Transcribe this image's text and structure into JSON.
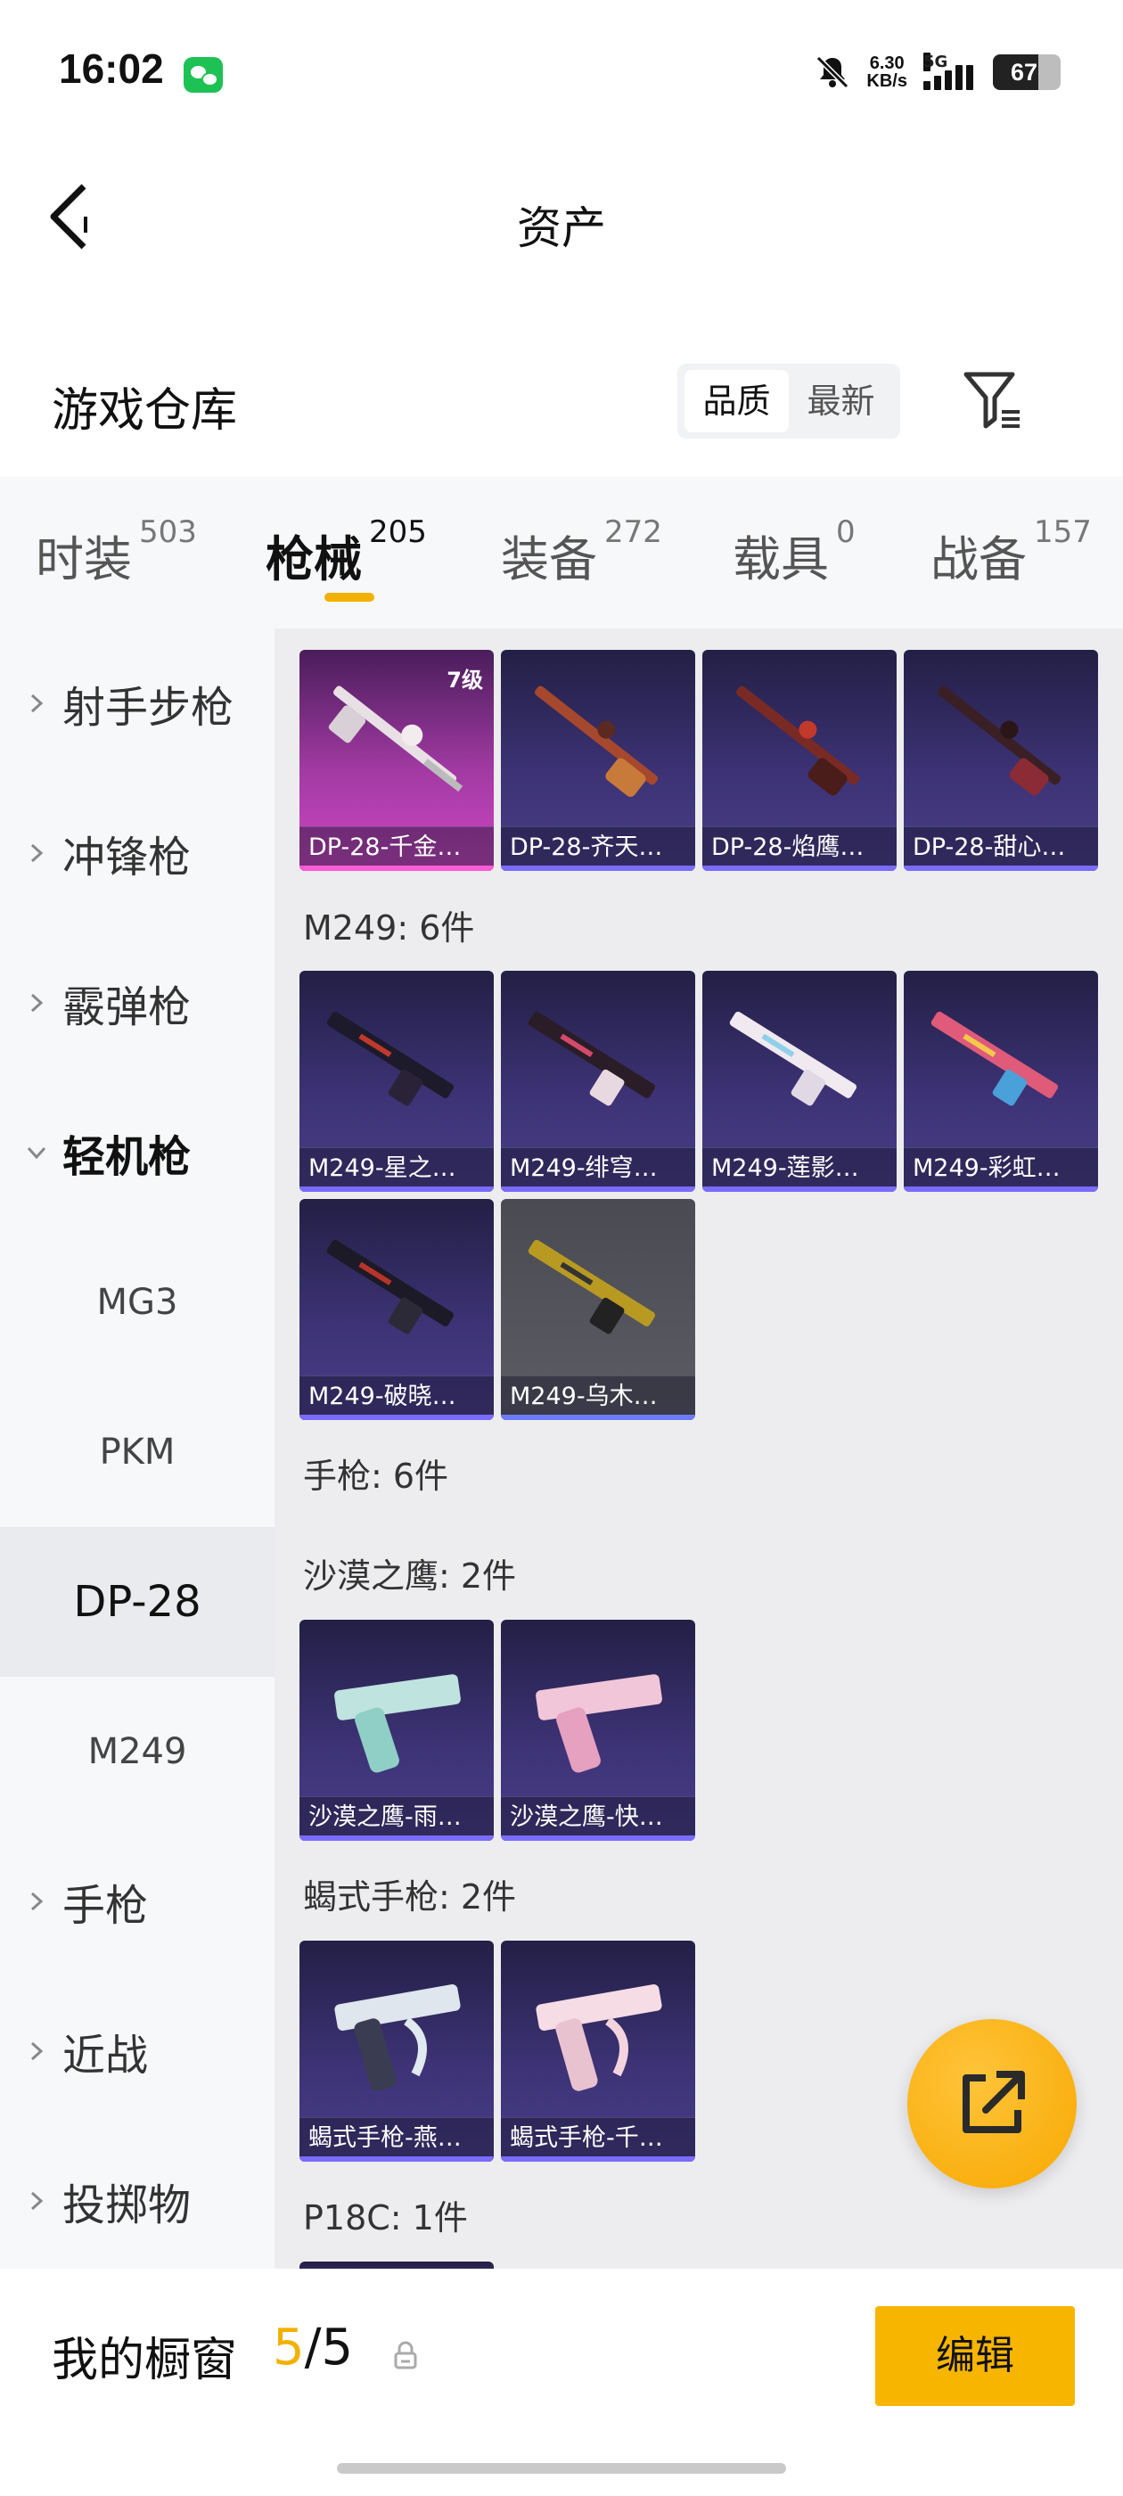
{
  "status_bar": {
    "time": "16:02",
    "net_speed_value": "6.30",
    "net_speed_unit": "KB/s",
    "network": "5G",
    "battery": "67"
  },
  "nav": {
    "title": "资产"
  },
  "warehouse": {
    "title": "游戏仓库",
    "sort_options": [
      "品质",
      "最新"
    ],
    "active_sort": "品质"
  },
  "tabs": [
    {
      "label": "时装",
      "count": "503"
    },
    {
      "label": "枪械",
      "count": "205"
    },
    {
      "label": "装备",
      "count": "272"
    },
    {
      "label": "载具",
      "count": "0"
    },
    {
      "label": "战备",
      "count": "157"
    }
  ],
  "active_tab": "枪械",
  "sidebar": {
    "items": [
      {
        "label": "射手步枪",
        "type": "category"
      },
      {
        "label": "冲锋枪",
        "type": "category"
      },
      {
        "label": "霰弹枪",
        "type": "category"
      },
      {
        "label": "轻机枪",
        "type": "category",
        "expanded": true
      },
      {
        "label": "MG3",
        "type": "sub"
      },
      {
        "label": "PKM",
        "type": "sub"
      },
      {
        "label": "DP-28",
        "type": "sub",
        "selected": true
      },
      {
        "label": "M249",
        "type": "sub"
      },
      {
        "label": "手枪",
        "type": "category"
      },
      {
        "label": "近战",
        "type": "category"
      },
      {
        "label": "投掷物",
        "type": "category"
      }
    ]
  },
  "content": {
    "dp28_cards": [
      {
        "name": "DP-28-千金…",
        "level": "7级"
      },
      {
        "name": "DP-28-齐天…"
      },
      {
        "name": "DP-28-焰鹰…"
      },
      {
        "name": "DP-28-甜心…"
      }
    ],
    "groups": {
      "m249": "M249: 6件",
      "pistol": "手枪: 6件",
      "deagle": "沙漠之鹰: 2件",
      "scorpion": "蝎式手枪: 2件",
      "p18c": "P18C: 1件"
    },
    "m249_cards": [
      {
        "name": "M249-星之…"
      },
      {
        "name": "M249-绯穹…"
      },
      {
        "name": "M249-莲影…"
      },
      {
        "name": "M249-彩虹…"
      },
      {
        "name": "M249-破晓…"
      },
      {
        "name": "M249-乌木…"
      }
    ],
    "deagle_cards": [
      {
        "name": "沙漠之鹰-雨…"
      },
      {
        "name": "沙漠之鹰-快…"
      }
    ],
    "scorpion_cards": [
      {
        "name": "蝎式手枪-燕…"
      },
      {
        "name": "蝎式手枪-千…"
      }
    ]
  },
  "showcase": {
    "label": "我的橱窗",
    "current": "5",
    "separator": "/",
    "total": "5",
    "edit_label": "编辑"
  },
  "colors": {
    "accent": "#f7b500",
    "card_purple": "#3c3274",
    "card_pink": "#d047c4"
  },
  "icons": [
    "back-arrow-icon",
    "filter-icon",
    "chevron-right-icon",
    "chevron-down-icon",
    "share-edit-icon",
    "lock-icon",
    "bell-muted-icon",
    "wechat-icon"
  ]
}
